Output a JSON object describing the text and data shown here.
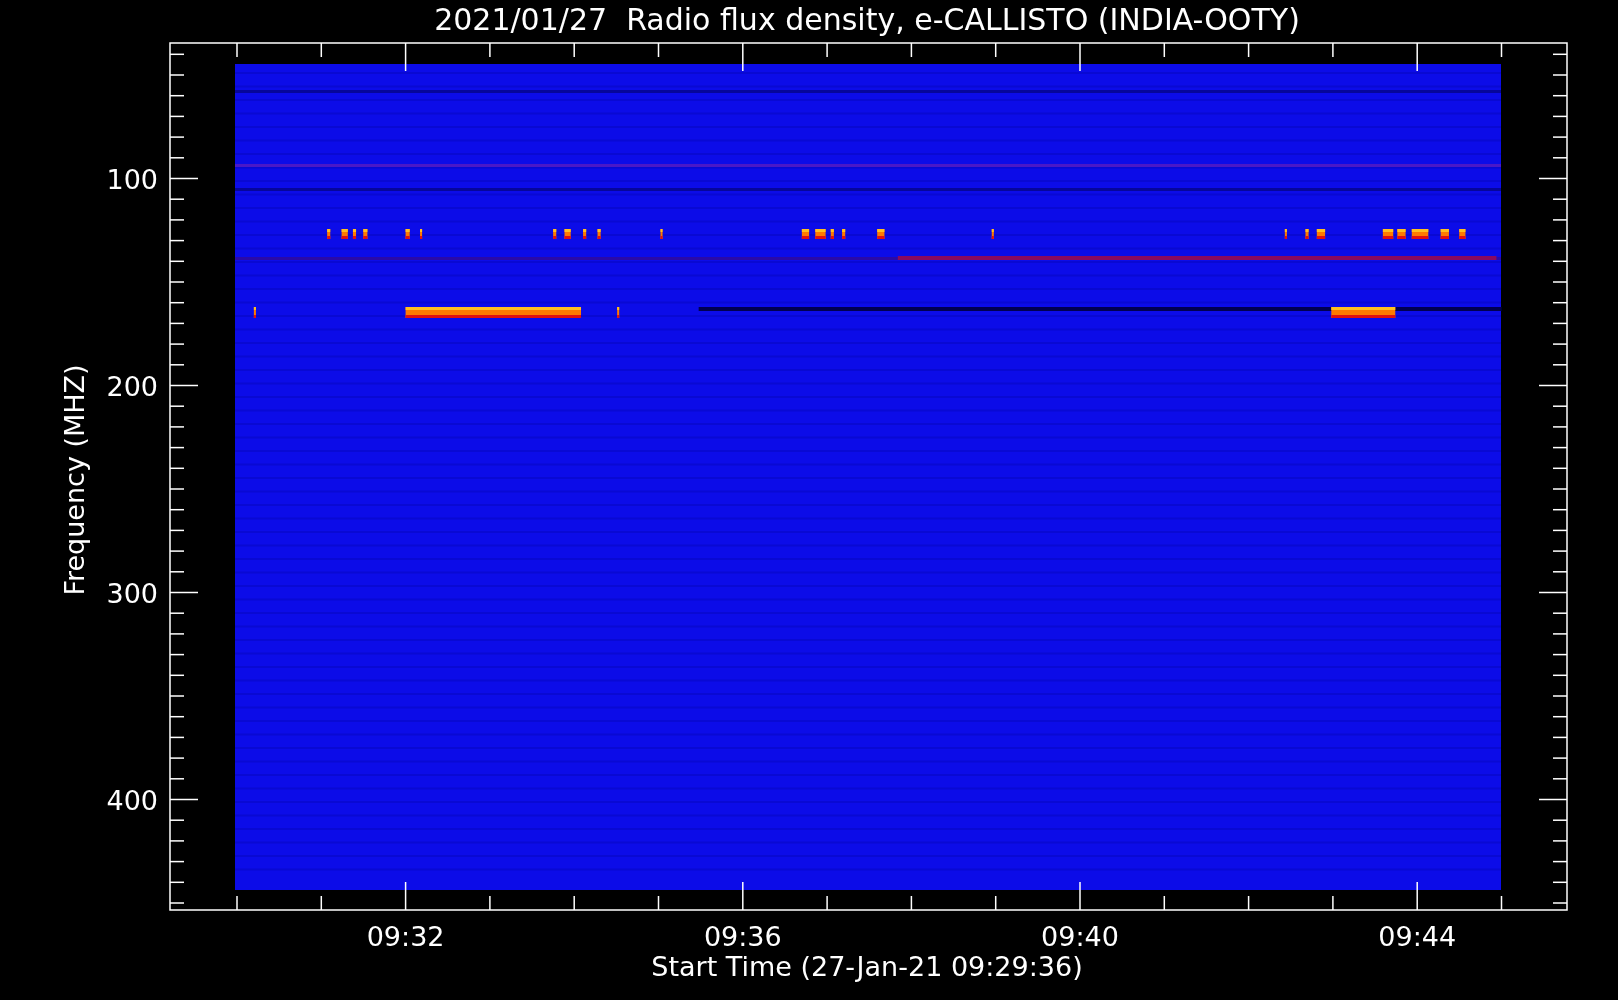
{
  "plot": {
    "title": "2021/01/27  Radio flux density, e-CALLISTO (INDIA-OOTY)",
    "ylabel": "Frequency (MHZ)",
    "xlabel": "Start Time (27-Jan-21 09:29:36)",
    "yticks": [
      "100",
      "200",
      "300",
      "400"
    ],
    "xticks": [
      "09:32",
      "09:36",
      "09:40",
      "09:44"
    ]
  }
}
